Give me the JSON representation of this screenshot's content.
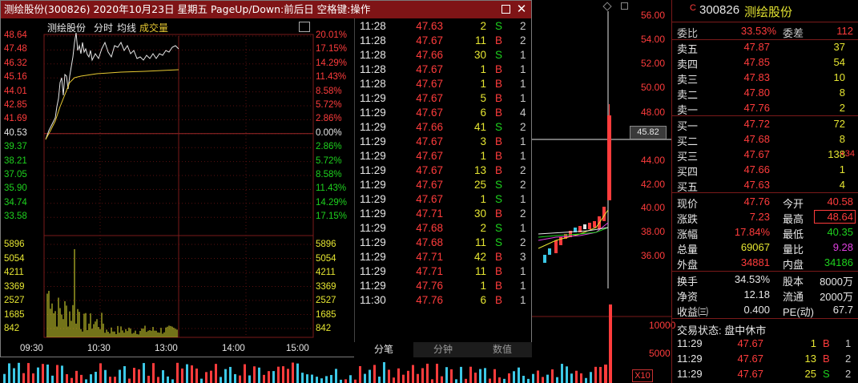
{
  "popup": {
    "title": "测绘股份(300826) 2020年10月23日 星期五 PageUp/Down:前后日 空格键:操作",
    "chart_header": {
      "name": "测绘股份",
      "mode": "分时",
      "avg": "均线",
      "vol": "成交量"
    },
    "price_labels": [
      "48.64",
      "47.48",
      "46.32",
      "45.16",
      "44.01",
      "42.85",
      "41.69",
      "40.53",
      "39.37",
      "38.21",
      "37.05",
      "35.90",
      "34.74",
      "33.58"
    ],
    "pct_labels": [
      "20.01%",
      "17.15%",
      "14.29%",
      "11.43%",
      "8.58%",
      "5.72%",
      "2.86%",
      "0.00%",
      "2.86%",
      "5.72%",
      "8.58%",
      "11.43%",
      "14.29%",
      "17.15%"
    ],
    "vol_labels": [
      "5896",
      "5054",
      "4211",
      "3369",
      "2527",
      "1685",
      "842"
    ],
    "time_labels": [
      "09:30",
      "10:30",
      "13:00",
      "14:00",
      "15:00"
    ],
    "ticks": [
      {
        "time": "11:28",
        "price": "47.63",
        "vol": "2",
        "bs": "S",
        "n": "2"
      },
      {
        "time": "11:28",
        "price": "47.67",
        "vol": "11",
        "bs": "B",
        "n": "2"
      },
      {
        "time": "11:28",
        "price": "47.66",
        "vol": "30",
        "bs": "S",
        "n": "1"
      },
      {
        "time": "11:28",
        "price": "47.67",
        "vol": "1",
        "bs": "B",
        "n": "1"
      },
      {
        "time": "11:28",
        "price": "47.67",
        "vol": "1",
        "bs": "B",
        "n": "1"
      },
      {
        "time": "11:29",
        "price": "47.67",
        "vol": "5",
        "bs": "B",
        "n": "1"
      },
      {
        "time": "11:29",
        "price": "47.67",
        "vol": "6",
        "bs": "B",
        "n": "4"
      },
      {
        "time": "11:29",
        "price": "47.66",
        "vol": "41",
        "bs": "S",
        "n": "2"
      },
      {
        "time": "11:29",
        "price": "47.67",
        "vol": "3",
        "bs": "B",
        "n": "1"
      },
      {
        "time": "11:29",
        "price": "47.67",
        "vol": "1",
        "bs": "B",
        "n": "1"
      },
      {
        "time": "11:29",
        "price": "47.67",
        "vol": "13",
        "bs": "B",
        "n": "2"
      },
      {
        "time": "11:29",
        "price": "47.67",
        "vol": "25",
        "bs": "S",
        "n": "2"
      },
      {
        "time": "11:29",
        "price": "47.67",
        "vol": "1",
        "bs": "S",
        "n": "1"
      },
      {
        "time": "11:29",
        "price": "47.71",
        "vol": "30",
        "bs": "B",
        "n": "2"
      },
      {
        "time": "11:29",
        "price": "47.68",
        "vol": "2",
        "bs": "S",
        "n": "1"
      },
      {
        "time": "11:29",
        "price": "47.68",
        "vol": "11",
        "bs": "S",
        "n": "2"
      },
      {
        "time": "11:29",
        "price": "47.71",
        "vol": "42",
        "bs": "B",
        "n": "3"
      },
      {
        "time": "11:29",
        "price": "47.71",
        "vol": "11",
        "bs": "B",
        "n": "1"
      },
      {
        "time": "11:29",
        "price": "47.76",
        "vol": "1",
        "bs": "B",
        "n": "1"
      },
      {
        "time": "11:30",
        "price": "47.76",
        "vol": "6",
        "bs": "B",
        "n": "1"
      }
    ],
    "tabs": [
      "分笔",
      "分钟",
      "数值"
    ]
  },
  "kline": {
    "axis": [
      "56.00",
      "54.00",
      "52.00",
      "50.00",
      "48.00",
      "44.00",
      "42.00",
      "40.00",
      "38.00",
      "36.00"
    ],
    "price_tag": "45.82",
    "vol_axis": [
      "10000",
      "5000"
    ],
    "vol_unit": "X10"
  },
  "quote": {
    "code": "300826",
    "name": "测绘股份",
    "weibi_label": "委比",
    "weibi": "33.53%",
    "weicha_label": "委差",
    "weicha": "112",
    "asks": [
      {
        "label": "卖五",
        "price": "47.87",
        "vol": "37"
      },
      {
        "label": "卖四",
        "price": "47.85",
        "vol": "54"
      },
      {
        "label": "卖三",
        "price": "47.83",
        "vol": "10"
      },
      {
        "label": "卖二",
        "price": "47.80",
        "vol": "8"
      },
      {
        "label": "卖一",
        "price": "47.76",
        "vol": "2"
      }
    ],
    "bids": [
      {
        "label": "买一",
        "price": "47.72",
        "vol": "72",
        "chg": ""
      },
      {
        "label": "买二",
        "price": "47.68",
        "vol": "8",
        "chg": ""
      },
      {
        "label": "买三",
        "price": "47.67",
        "vol": "138",
        "chg": "+34"
      },
      {
        "label": "买四",
        "price": "47.66",
        "vol": "1",
        "chg": ""
      },
      {
        "label": "买五",
        "price": "47.63",
        "vol": "4",
        "chg": ""
      }
    ],
    "stats": [
      {
        "l1": "现价",
        "v1": "47.76",
        "l2": "今开",
        "v2": "40.58"
      },
      {
        "l1": "涨跌",
        "v1": "7.23",
        "l2": "最高",
        "v2": "48.64"
      },
      {
        "l1": "涨幅",
        "v1": "17.84%",
        "l2": "最低",
        "v2": "40.35"
      },
      {
        "l1": "总量",
        "v1": "69067",
        "l2": "量比",
        "v2": "9.28"
      },
      {
        "l1": "外盘",
        "v1": "34881",
        "l2": "内盘",
        "v2": "34186"
      }
    ],
    "fund": [
      {
        "l1": "换手",
        "v1": "34.53%",
        "l2": "股本",
        "v2": "8000万"
      },
      {
        "l1": "净资",
        "v1": "12.18",
        "l2": "流通",
        "v2": "2000万"
      },
      {
        "l1": "收益㈢",
        "v1": "0.400",
        "l2": "PE(动)",
        "v2": "67.7"
      }
    ],
    "status": "交易状态: 盘中休市",
    "recent": [
      {
        "time": "11:29",
        "price": "47.67",
        "vol": "1",
        "bs": "B",
        "n": "1"
      },
      {
        "time": "11:29",
        "price": "47.67",
        "vol": "13",
        "bs": "B",
        "n": "2"
      },
      {
        "time": "11:29",
        "price": "47.67",
        "vol": "25",
        "bs": "S",
        "n": "2"
      }
    ]
  }
}
